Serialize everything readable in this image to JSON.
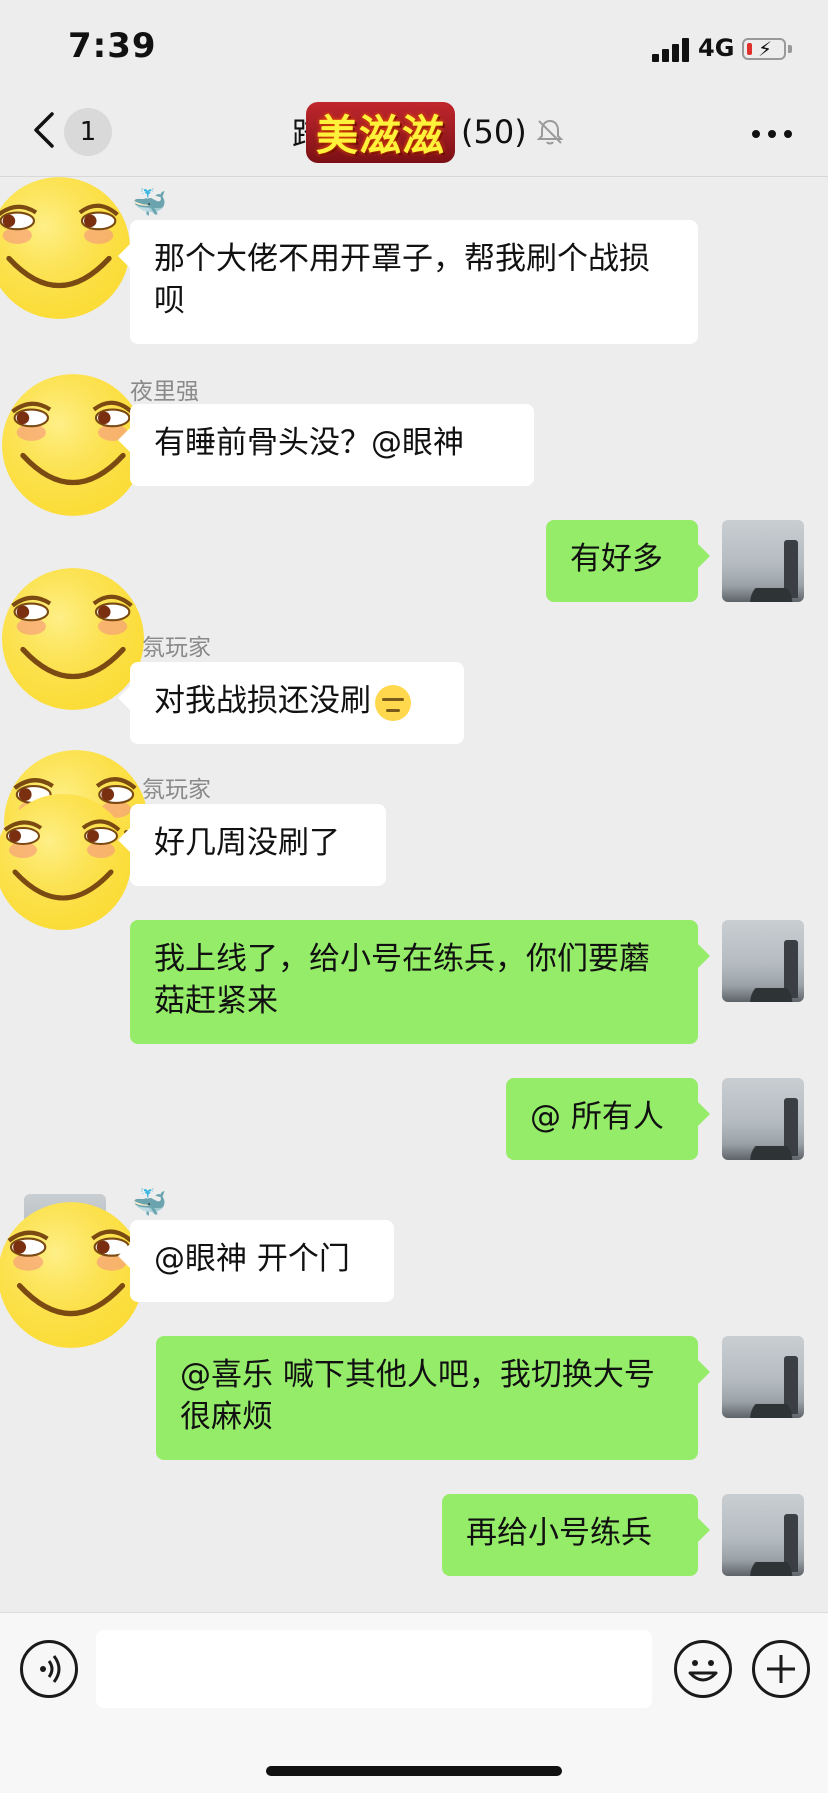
{
  "status_bar": {
    "time": "7:39",
    "network": "4G"
  },
  "nav": {
    "unread_count": "1",
    "title_prefix": "踏",
    "title_sticker_text": "美滋滋",
    "member_count": "(50)"
  },
  "messages": [
    {
      "side": "in",
      "sender": "",
      "text": "那个大佬不用开罩子，帮我刷个战损呗"
    },
    {
      "side": "in",
      "sender": "夜里强",
      "text": "有睡前骨头没？@眼神"
    },
    {
      "side": "out",
      "text": "有好多"
    },
    {
      "side": "in",
      "sender": "氛玩家",
      "text": "对我战损还没刷"
    },
    {
      "side": "in",
      "sender": "氛玩家",
      "text": "好几周没刷了"
    },
    {
      "side": "out",
      "text": "我上线了，给小号在练兵，你们要蘑菇赶紧来"
    },
    {
      "side": "out",
      "text": "@ 所有人"
    },
    {
      "side": "in",
      "sender": "",
      "text": "@眼神 开个门"
    },
    {
      "side": "out",
      "text": "@喜乐 喊下其他人吧，我切换大号很麻烦"
    },
    {
      "side": "out",
      "text": "再给小号练兵"
    }
  ],
  "icons": {
    "back": "chevron-left-icon",
    "mute": "bell-off-icon",
    "more": "more-dots-icon",
    "voice": "voice-icon",
    "emoji": "emoji-icon",
    "plus": "plus-icon",
    "whale": "🐳"
  },
  "colors": {
    "out_bubble": "#95ec69",
    "in_bubble": "#ffffff",
    "background": "#ededed"
  }
}
